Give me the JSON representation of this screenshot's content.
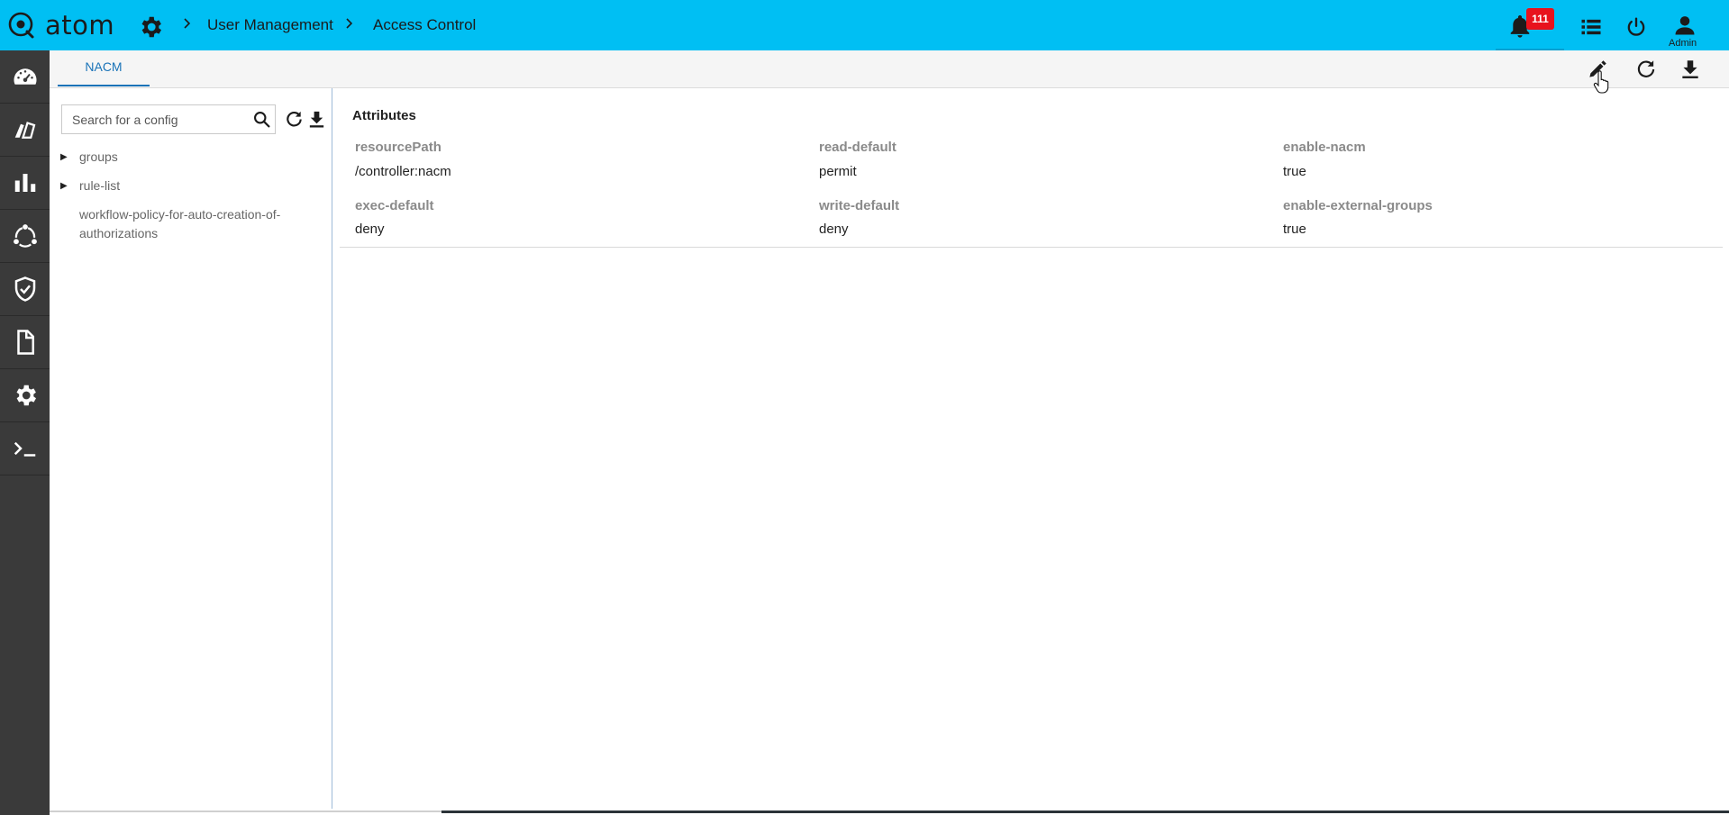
{
  "app": {
    "logo_text": "atom"
  },
  "breadcrumb": {
    "items": [
      "User Management",
      "Access Control"
    ]
  },
  "header": {
    "notification_count": "111",
    "user_label": "Admin"
  },
  "sidebar": {
    "items": [
      {
        "name": "dashboard-icon"
      },
      {
        "name": "devices-icon"
      },
      {
        "name": "analytics-icon"
      },
      {
        "name": "topology-icon"
      },
      {
        "name": "security-icon"
      },
      {
        "name": "document-icon"
      },
      {
        "name": "settings-icon"
      },
      {
        "name": "terminal-icon"
      }
    ]
  },
  "tabs": [
    {
      "label": "NACM"
    }
  ],
  "config": {
    "search_placeholder": "Search for a config",
    "tree": [
      {
        "label": "groups",
        "expandable": true
      },
      {
        "label": "rule-list",
        "expandable": true
      },
      {
        "label": "workflow-policy-for-auto-creation-of-authorizations",
        "expandable": false
      }
    ]
  },
  "attributes": {
    "title": "Attributes",
    "items": [
      {
        "key": "resourcePath",
        "value": "/controller:nacm"
      },
      {
        "key": "read-default",
        "value": "permit"
      },
      {
        "key": "enable-nacm",
        "value": "true"
      },
      {
        "key": "exec-default",
        "value": "deny"
      },
      {
        "key": "write-default",
        "value": "deny"
      },
      {
        "key": "enable-external-groups",
        "value": "true"
      }
    ]
  },
  "colors": {
    "topbar": "#00bff3",
    "rail": "#3a3a3a",
    "accent": "#1a73b8",
    "badge": "#e8121c"
  }
}
